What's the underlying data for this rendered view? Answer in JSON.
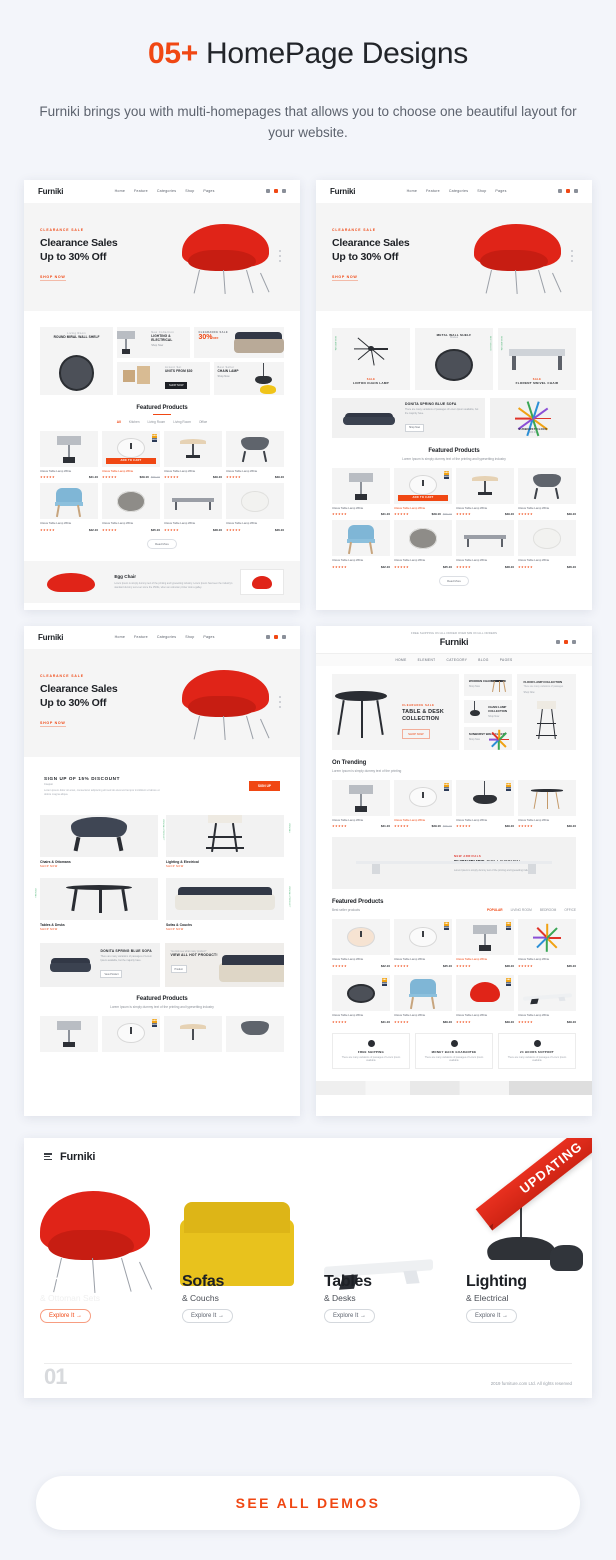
{
  "header": {
    "title_accent": "05+",
    "title_rest": " HomePage Designs",
    "subtitle": "Furniki brings you with multi-homepages that allows you to choose one beautiful layout for your website."
  },
  "colors": {
    "accent": "#f04713",
    "page_bg": "#f3f5fa",
    "card_bg": "#ffffff",
    "text_dark": "#1d2025",
    "text_muted": "#8b9098",
    "ribbon": "#e8301f"
  },
  "cta": {
    "see_all_demos": "SEE ALL DEMOS"
  },
  "brand": {
    "logo": "Furniki"
  },
  "nav": {
    "items": [
      "Home",
      "Feature",
      "Categories",
      "Shop",
      "Pages"
    ]
  },
  "nav4": {
    "items": [
      "HOME",
      "ELEMENT",
      "CATEGORY",
      "BLOG",
      "PAGES"
    ]
  },
  "hero": {
    "eyebrow": "CLEARANCE SALE",
    "title_line1": "Clearance Sales",
    "title_line2": "Up to 30% Off",
    "link": "SHOP NOW"
  },
  "demo1": {
    "tiles": [
      {
        "eyebrow": "Living Room",
        "label": "ROUND MIRAL WALL SHELF"
      },
      {
        "eyebrow": "New Collection",
        "label": "LIGHTING & ELECTRICAL",
        "more": "Shop Now"
      },
      {
        "eyebrow": "CLEARANCE SALE",
        "pct": "30%",
        "pct_suffix": "OFF"
      },
      {
        "eyebrow": "Accent Set",
        "label": "UNITS FROM $30",
        "button": "SHOP NOW"
      },
      {
        "eyebrow": "Best Seller",
        "label": "CHAIN LAMP",
        "more": "Shop Now"
      }
    ],
    "featured": {
      "title": "Featured Products",
      "tabs": [
        "All",
        "Kitchen",
        "Living Room",
        "Living Room",
        "Office"
      ],
      "active_tab": "All",
      "products": [
        {
          "name": "Uttous Table Lamp White",
          "stars": "★★★★★",
          "price": "$41.10"
        },
        {
          "name": "Uttous Table Lamp White",
          "stars": "★★★★★",
          "price": "$39.10",
          "old": "$55.00",
          "hot": true,
          "cta": "ADD TO CART"
        },
        {
          "name": "Uttous Table Lamp White",
          "stars": "★★★★★",
          "price": "$49.10"
        },
        {
          "name": "Uttous Table Lamp White",
          "stars": "★★★★★",
          "price": "$49.10"
        },
        {
          "name": "Uttous Table Lamp White",
          "stars": "★★★★★",
          "price": "$42.10"
        },
        {
          "name": "Uttous Table Lamp White",
          "stars": "★★★★★",
          "price": "$45.10"
        },
        {
          "name": "Uttous Table Lamp White",
          "stars": "★★★★★",
          "price": "$48.10"
        },
        {
          "name": "Uttous Table Lamp White",
          "stars": "★★★★★",
          "price": "$46.10"
        }
      ],
      "more_button": "Read More"
    },
    "promo": {
      "title": "Egg Chair",
      "desc": "Lorem Ipsum is simply dummy text of the printing and typesetting industry. Lorem Ipsum has been the industry's standard dummy text ever since the 1500s, when an unknown printer took a galley."
    }
  },
  "demo2": {
    "tiles": [
      {
        "eyebrow": "SALE",
        "label": "LINTON CHAIN LAMP",
        "vtext": "NEW ARRIVAL"
      },
      {
        "eyebrow": "",
        "label": "METAL WALL SHELF",
        "sub": "Shelves",
        "vtext": "BEST SELLER"
      },
      {
        "eyebrow": "SALE",
        "label": "FLORENT SWIVEL CHAIR",
        "vtext": "NEW ARRIVAL"
      }
    ],
    "banner": {
      "title": "DONITA SPRING BLUE SOFA",
      "desc": "There are many variations of passages of Lorem Ipsum available, but the majority have.",
      "button": "Shop Now"
    },
    "clock": {
      "label": "SUNBURST CLOCK",
      "price": "$59.00"
    },
    "featured": {
      "title": "Featured Products",
      "subtitle": "Lorem Ipsum is simply dummy text of the printing and typesetting industry",
      "more_button": "Read More"
    }
  },
  "demo3": {
    "signup": {
      "title": "SIGN UP OF 15% DISCOUNT",
      "sub": "Coupon",
      "desc": "Lorem ipsum dolor sit amet, consectetur adipiscing elit sed do eiusmod tempor incididunt ut labore et dolore magna aliqua.",
      "button": "SIGN UP"
    },
    "categories": [
      {
        "name": "Chairs & Ottomans",
        "link": "SHOP NOW",
        "vtext": "VIEW ALL PRODUCT"
      },
      {
        "name": "Lighting & Electrical",
        "link": "SHOP NOW",
        "vtext": "VIEW ALL"
      },
      {
        "name": "Tables & Desks",
        "link": "SHOP NOW",
        "vtext": "VIEW ALL"
      },
      {
        "name": "Sofas & Couchs",
        "link": "SHOP NOW",
        "vtext": "VIEW ALL PRODUCT"
      }
    ],
    "banners": [
      {
        "title": "DONITA SPRING BLUE SOFA",
        "desc": "There are many variations of passages of Lorem Ipsum available, but the majority have.",
        "button": "View Product"
      },
      {
        "eyebrow": "You look see what many product?",
        "title": "VIEW ALL HOT PRODUCT!",
        "button": "Product"
      }
    ],
    "featured": {
      "title": "Featured Products",
      "subtitle": "Lorem Ipsum is simply dummy text of the printing and typesetting industry"
    }
  },
  "demo4": {
    "announce": "FREE SHIPPING ON ALL ORDER OVER $99 ON ALL ORDERS",
    "announce_accent": "$99",
    "hero": {
      "eyebrow": "CLEARANCE SALE",
      "title": "TABLE & DESK COLLECTION",
      "button": "SHOP NOW"
    },
    "hero_tiles": [
      {
        "title": "WOODEN CHAIR",
        "link": "Shop Now"
      },
      {
        "title": "CHAIN LAMP COLLECTION",
        "link": "Shop Now"
      },
      {
        "title": "SUNBURST WALL CLOCK",
        "link": "Shop Now"
      },
      {
        "title": "FLOOR LAMP COLLECTION",
        "desc": "There are many variations of passages",
        "link": "Shop Now"
      }
    ],
    "trending": {
      "title": "On Trending",
      "subtitle": "Lorem Ipsum is simply dummy text of the printing"
    },
    "banner": {
      "eyebrow": "NEW ARRIVALS",
      "title_bold": "FURNITURE",
      "title_rest": " COLLECTION",
      "desc": "Lorem Ipsum is simply dummy text of the printing and typesetting industry"
    },
    "featured": {
      "title": "Featured Products",
      "subtitle": "Best seller products",
      "tabs": [
        "POPULAR",
        "LIVING ROOM",
        "BEDROOM",
        "OFFICE"
      ],
      "active_tab": "POPULAR"
    },
    "services": [
      {
        "title": "FREE SHIPPING",
        "desc": "There are many variations of passages of Lorem Ipsum available"
      },
      {
        "title": "MONEY BACK GUARANTEE",
        "desc": "There are many variations of passages of Lorem Ipsum available"
      },
      {
        "title": "24 HOURS SUPPORT",
        "desc": "There are many variations of passages of Lorem Ipsum available"
      }
    ]
  },
  "demo5": {
    "ribbon": "UPDATING",
    "logo": "Furniki",
    "counter": "01",
    "copyright": "2019 furniture.com Ltd. All rights reserved",
    "categories": [
      {
        "title": "Chairs",
        "subtitle": "& Ottoman Sets",
        "button": "Explore It  →",
        "active": true
      },
      {
        "title": "Sofas",
        "subtitle": "& Couchs",
        "button": "Explore It  →",
        "active": false
      },
      {
        "title": "Tables",
        "subtitle": "& Desks",
        "button": "Explore It  →",
        "active": false
      },
      {
        "title": "Lighting",
        "subtitle": "& Electrical",
        "button": "Explore It  →",
        "active": false
      }
    ]
  }
}
